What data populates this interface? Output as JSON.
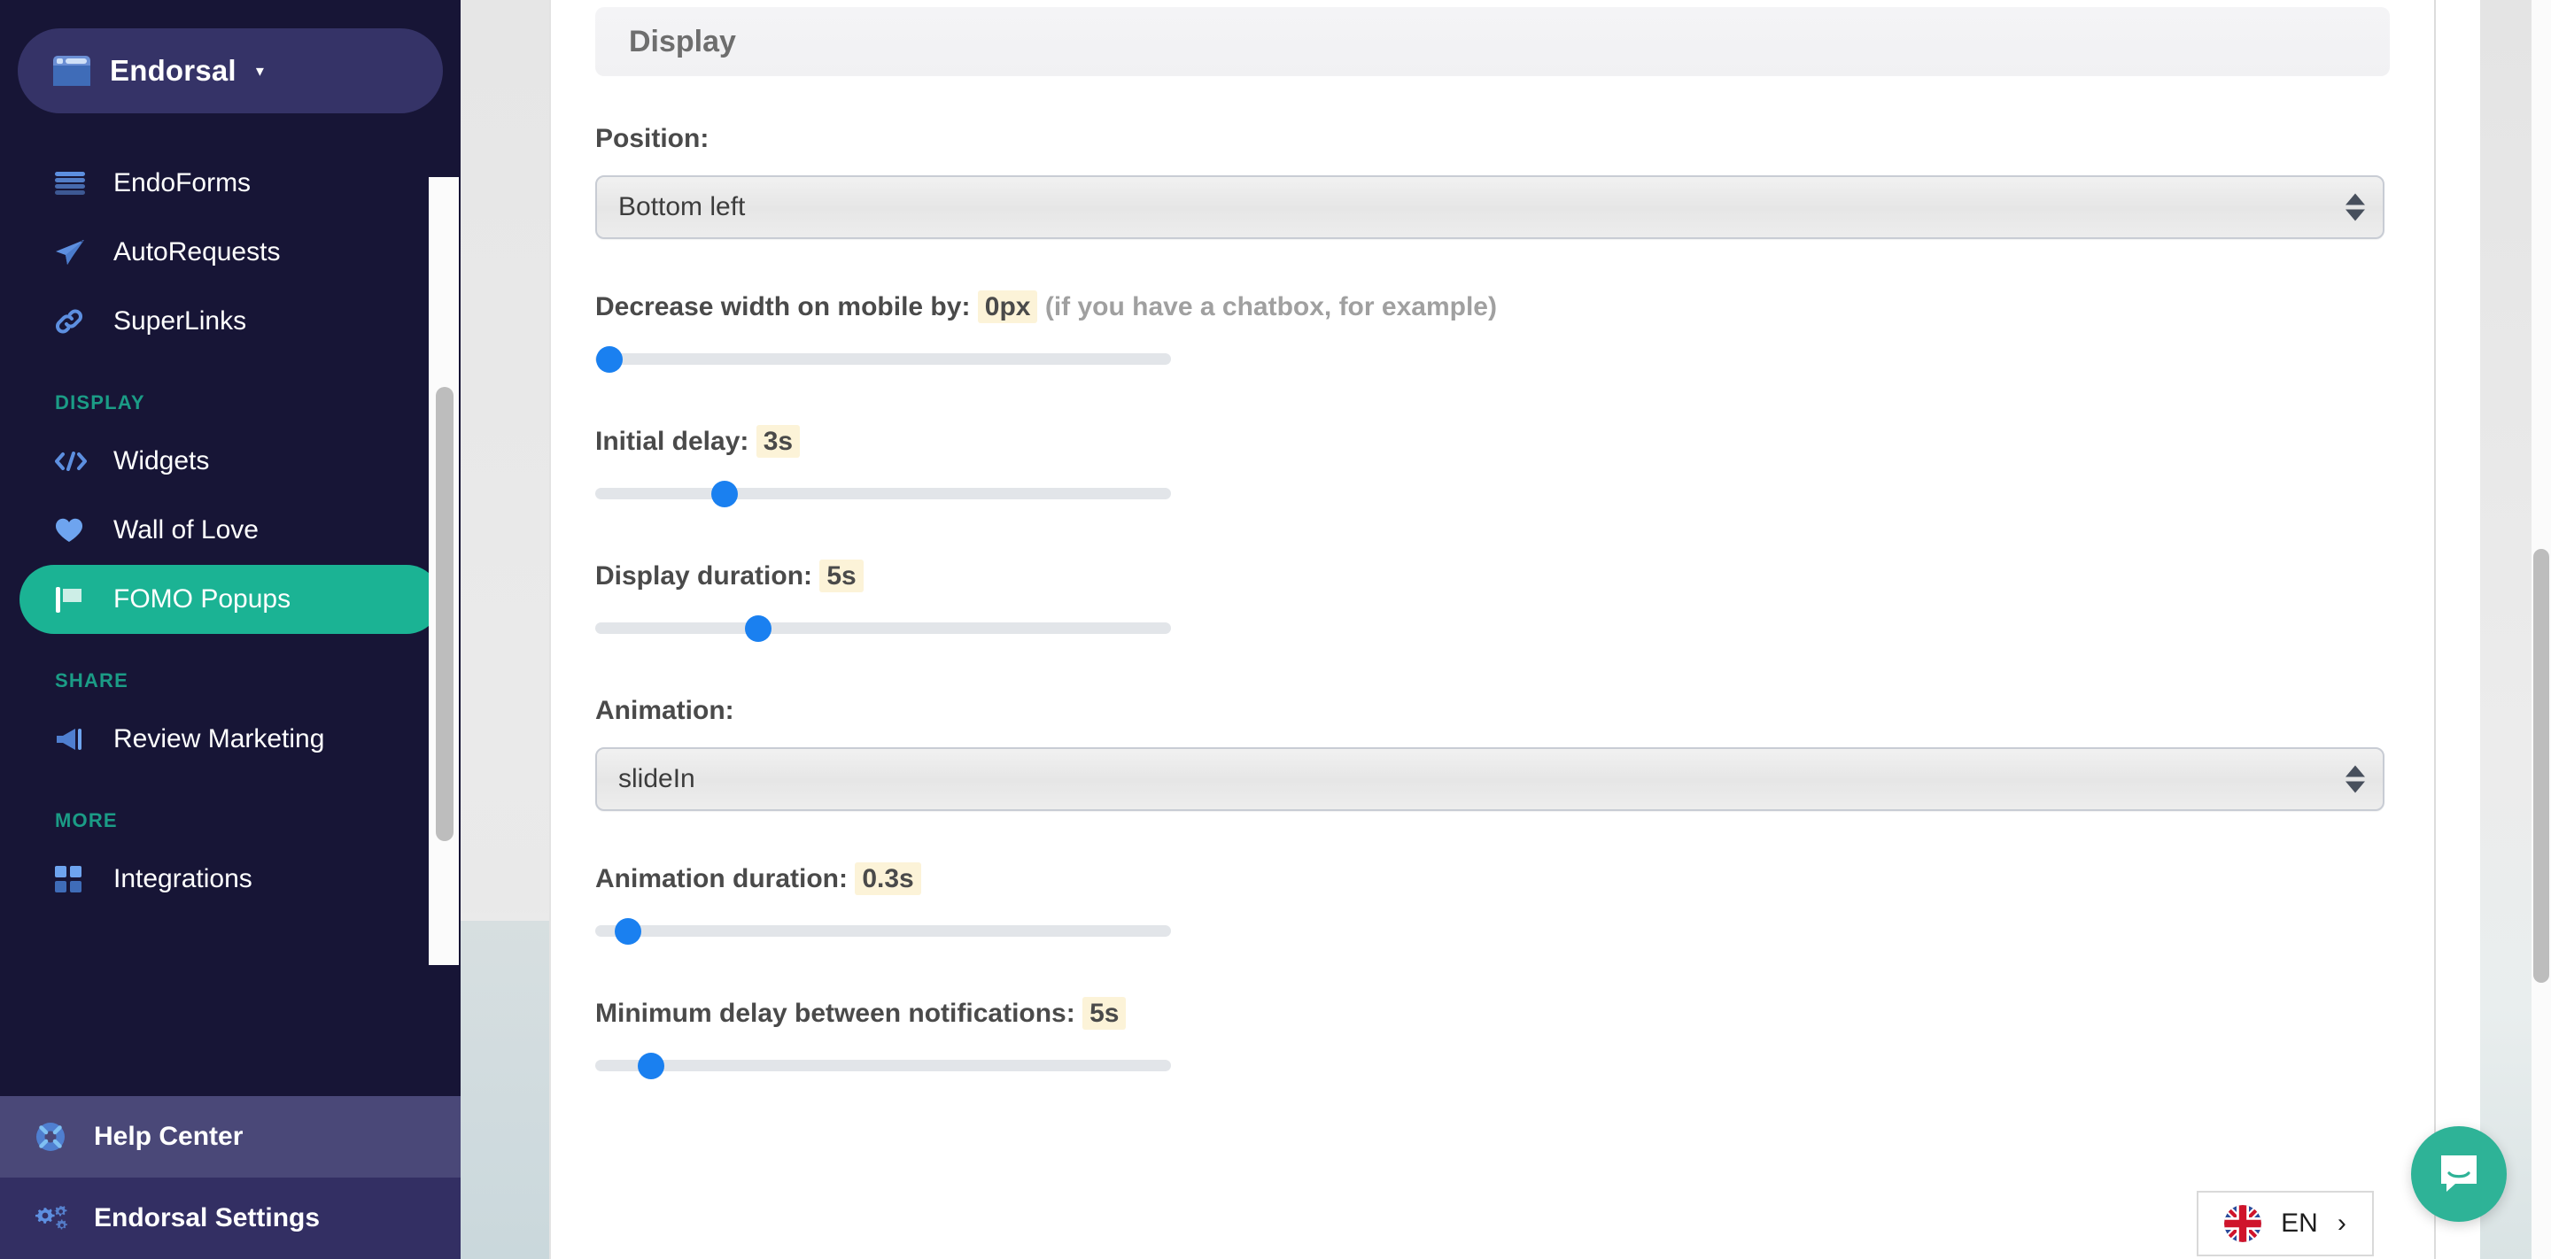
{
  "sidebar": {
    "brand": {
      "name": "Endorsal",
      "icon": "browser-window-icon",
      "caret": "▾"
    },
    "nav": [
      {
        "label": "EndoForms",
        "icon": "list-lines-icon",
        "active": false
      },
      {
        "label": "AutoRequests",
        "icon": "paper-plane-icon",
        "active": false
      },
      {
        "label": "SuperLinks",
        "icon": "link-chain-icon",
        "active": false
      }
    ],
    "groups": [
      {
        "title": "DISPLAY",
        "items": [
          {
            "label": "Widgets",
            "icon": "code-brackets-icon",
            "active": false
          },
          {
            "label": "Wall of Love",
            "icon": "heart-icon",
            "active": false
          },
          {
            "label": "FOMO Popups",
            "icon": "flag-icon",
            "active": true
          }
        ]
      },
      {
        "title": "SHARE",
        "items": [
          {
            "label": "Review Marketing",
            "icon": "megaphone-icon",
            "active": false
          }
        ]
      },
      {
        "title": "MORE",
        "items": [
          {
            "label": "Integrations",
            "icon": "grid-squares-icon",
            "active": false
          }
        ]
      }
    ],
    "bottom": [
      {
        "label": "Help Center",
        "icon": "life-ring-icon"
      },
      {
        "label": "Endorsal Settings",
        "icon": "gears-icon"
      }
    ],
    "colors": {
      "background": "#171536",
      "brand_pill": "#353367",
      "active": "#1bb394",
      "group_title": "#1b9c86",
      "help_band": "#4a4878",
      "settings_band": "#332f63"
    }
  },
  "main": {
    "card_title": "Display",
    "fields": {
      "position": {
        "label": "Position:",
        "value": "Bottom left"
      },
      "decrease_width": {
        "label_prefix": "Decrease width on mobile by:",
        "value": "0px",
        "hint": "(if you have a chatbox, for example)",
        "slider_percent": 1
      },
      "initial_delay": {
        "label_prefix": "Initial delay:",
        "value": "3s",
        "slider_percent": 23
      },
      "display_duration": {
        "label_prefix": "Display duration:",
        "value": "5s",
        "slider_percent": 29
      },
      "animation": {
        "label": "Animation:",
        "value": "slideIn"
      },
      "animation_duration": {
        "label_prefix": "Animation duration:",
        "value": "0.3s",
        "slider_percent": 4
      },
      "minimum_delay": {
        "label_prefix": "Minimum delay between notifications:",
        "value": "5s",
        "slider_percent": 8
      }
    },
    "colors": {
      "value_badge_bg": "#fcf3d8",
      "slider_thumb": "#1a80f0",
      "slider_track": "#e2e5e9",
      "label_text": "#4a4a4a",
      "hint_text": "#a0a0a0"
    }
  },
  "widgets": {
    "language": {
      "code": "EN",
      "flag": "uk-flag-icon",
      "chevron": "›"
    },
    "chat": {
      "icon": "intercom-chat-icon",
      "color": "#2eb397"
    }
  }
}
